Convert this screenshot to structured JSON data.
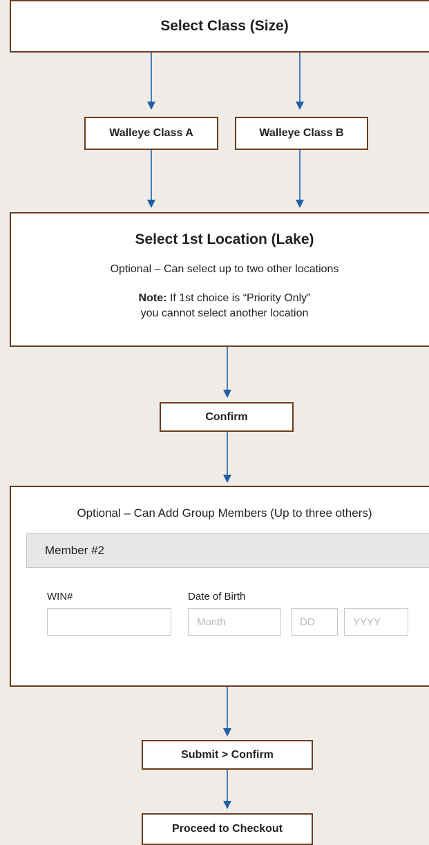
{
  "flow": {
    "select_class": "Select Class (Size)",
    "class_a": "Walleye Class A",
    "class_b": "Walleye Class B",
    "location": {
      "title": "Select 1st Location (Lake)",
      "optional": "Optional – Can select up to two other locations",
      "note_label": "Note:",
      "note_line1": " If 1st choice is “Priority Only”",
      "note_line2": "you cannot select another location"
    },
    "confirm": "Confirm",
    "group": {
      "optional": "Optional – Can Add Group Members (Up to three others)",
      "member_header": "Member #2",
      "win_label": "WIN#",
      "dob_label": "Date of Birth",
      "month_placeholder": "Month",
      "day_placeholder": "DD",
      "year_placeholder": "YYYY"
    },
    "submit_confirm": "Submit > Confirm",
    "checkout": "Proceed to Checkout"
  },
  "colors": {
    "background": "#efebe6",
    "box_border": "#6b3d1f",
    "arrow": "#1f5fa8",
    "member_header_bg": "#e6e7e8"
  }
}
